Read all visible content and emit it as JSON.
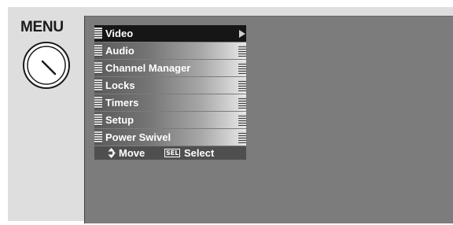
{
  "remote": {
    "button_label": "MENU",
    "button_icon": "dial-icon"
  },
  "menu": {
    "items": [
      {
        "label": "Video",
        "selected": true
      },
      {
        "label": "Audio",
        "selected": false
      },
      {
        "label": "Channel Manager",
        "selected": false
      },
      {
        "label": "Locks",
        "selected": false
      },
      {
        "label": "Timers",
        "selected": false
      },
      {
        "label": "Setup",
        "selected": false
      },
      {
        "label": "Power Swivel",
        "selected": false
      }
    ]
  },
  "footer": {
    "move_icon": "up-down-arrows-icon",
    "move_label": "Move",
    "sel_key": "SEL",
    "select_label": "Select"
  },
  "colors": {
    "screen_bg": "#7c7c7c",
    "selected_item": "#161616",
    "footer_bg": "#4f4f4f"
  }
}
